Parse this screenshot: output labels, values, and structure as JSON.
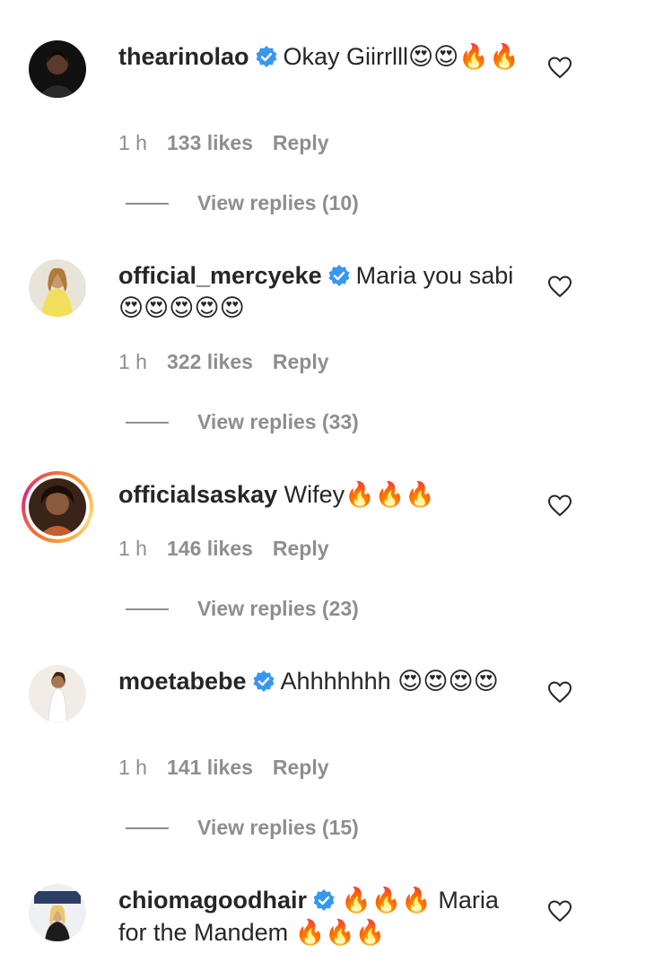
{
  "comments": [
    {
      "username": "thearinolao",
      "verified": true,
      "text": "Okay Giirrlll😍😍🔥🔥",
      "time": "1 h",
      "likes": "133 likes",
      "reply": "Reply",
      "view_replies": "View replies (10)",
      "story_ring": false
    },
    {
      "username": "official_mercyeke",
      "verified": true,
      "text": "Maria you sabi 😍😍😍😍😍",
      "time": "1 h",
      "likes": "322 likes",
      "reply": "Reply",
      "view_replies": "View replies (33)",
      "story_ring": false
    },
    {
      "username": "officialsaskay",
      "verified": false,
      "text": "Wifey🔥🔥🔥",
      "time": "1 h",
      "likes": "146 likes",
      "reply": "Reply",
      "view_replies": "View replies (23)",
      "story_ring": true
    },
    {
      "username": "moetabebe",
      "verified": true,
      "text": "Ahhhhhhh 😍😍😍😍",
      "time": "1 h",
      "likes": "141 likes",
      "reply": "Reply",
      "view_replies": "View replies (15)",
      "story_ring": false
    },
    {
      "username": "chiomagoodhair",
      "verified": true,
      "text": "🔥🔥🔥 Maria for the Mandem 🔥🔥🔥",
      "story_ring": false
    }
  ],
  "icons": {
    "like": "heart-outline-icon",
    "verified": "verified-badge-icon"
  },
  "colors": {
    "text": "#262626",
    "meta": "#8e8e8e",
    "verified": "#3897f0"
  }
}
